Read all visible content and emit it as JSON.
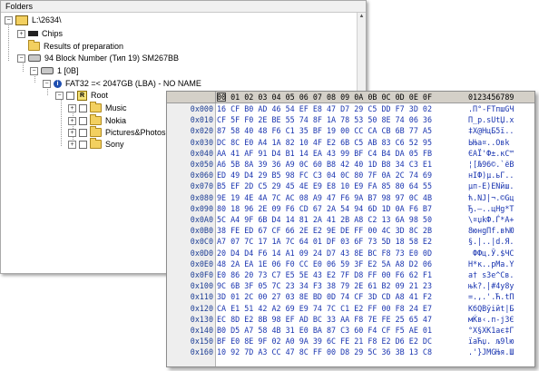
{
  "folders_panel": {
    "title": "Folders",
    "items": [
      {
        "label": "L:\\2634\\",
        "icon": "drive-folder-icon"
      },
      {
        "label": "Chips",
        "icon": "chip-icon"
      },
      {
        "label": "Results of preparation",
        "icon": "folder-icon"
      },
      {
        "label": "94 Block Number (Тип 19) SM267BB",
        "icon": "disk-icon"
      },
      {
        "label": "1 [0B]",
        "icon": "disk-icon"
      },
      {
        "label": "FAT32 =< 2047GB (LBA) - NO NAME",
        "icon": "info-icon"
      },
      {
        "label": "Root",
        "icon": "root-icon"
      },
      {
        "label": "Music",
        "icon": "folder-icon"
      },
      {
        "label": "Nokia",
        "icon": "folder-icon"
      },
      {
        "label": "Pictures&Photos",
        "icon": "folder-icon"
      },
      {
        "label": "Sony",
        "icon": "folder-icon"
      }
    ]
  },
  "hex_view": {
    "columns": "00 01 02 03 04 05 06 07 08 09 0A 0B 0C 0D 0E 0F",
    "ascii_header": "0123456789",
    "rows": [
      {
        "addr": "0x000",
        "hex": "16 CF B0 AD 46 54 EF E8 47 D7 29 C5 DD F7 3D 02",
        "ascii": ".П°-FTпшGЧ"
      },
      {
        "addr": "0x010",
        "hex": "CF 5F F0 2E BE 55 74 8F 1A 78 53 50 8E 74 06 36",
        "ascii": "П_р.sUtЏ.x"
      },
      {
        "addr": "0x020",
        "hex": "87 58 40 48 F6 C1 35 BF 19 00 CC CA CB 6B 77 A5",
        "ascii": "‡X@HцБ5ї.."
      },
      {
        "addr": "0x030",
        "hex": "DC 8C E0 A4 1A 82 10 4F E2 6B C5 AB 83 C6 52 95",
        "ascii": "ЬЊа¤..Oвk"
      },
      {
        "addr": "0x040",
        "hex": "AA 41 AF 91 D4 B1 14 EA 43 99 BF C4 B4 DA 05 FB",
        "ascii": "ЄAЇ'Ф±.кC™"
      },
      {
        "addr": "0x050",
        "hex": "A6 5B 8A 39 36 A9 0C 60 B8 42 40 1D B8 34 C3 E1",
        "ascii": "¦[Љ96©.`ёB"
      },
      {
        "addr": "0x060",
        "hex": "ED 49 D4 29 B5 98 FC C3 04 0C 80 7F 0A 2C 74 69",
        "ascii": "нIФ)µ.ьГ.."
      },
      {
        "addr": "0x070",
        "hex": "B5 EF 2D C5 29 45 4E E9 E8 10 E9 FA 85 80 64 55",
        "ascii": "µп-Е)ENйш."
      },
      {
        "addr": "0x080",
        "hex": "9E 19 4E 4A 7C AC 08 A9 47 F6 9A B7 98 97 0C 4B",
        "ascii": "ћ.NJ|¬.©Gц"
      },
      {
        "addr": "0x090",
        "hex": "80 18 96 2E 09 F6 CD 67 2A 54 94 6D 1D 0A F6 B7",
        "ascii": "Ђ.–..цНg*T"
      },
      {
        "addr": "0x0A0",
        "hex": "5C A4 9F 6B D4 14 81 2A 41 2B A8 C2 13 6A 98 50",
        "ascii": "\\¤џkФ.Ѓ*A+"
      },
      {
        "addr": "0x0B0",
        "hex": "38 FE ED 67 CF 66 2E E2 9E DE FF 00 4C 3D 8C 2B",
        "ascii": "8юнgПf.вћЮ"
      },
      {
        "addr": "0x0C0",
        "hex": "A7 07 7C 17 1A 7C 64 01 DF 03 6F 73 5D 18 58 E2",
        "ascii": "§.|..|d.Я."
      },
      {
        "addr": "0x0D0",
        "hex": "20 D4 D4 F6 14 A1 09 24 D7 43 8E BC F8 73 E0 0D",
        "ascii": " ФФц.Ў.$ЧC"
      },
      {
        "addr": "0x0E0",
        "hex": "48 2A EA 1E 06 F0 CC E0 06 59 3F E2 5A A8 D2 06",
        "ascii": "H*к..рМа.Y"
      },
      {
        "addr": "0x0F0",
        "hex": "E0 86 20 73 C7 E5 5E 43 E2 7F D8 FF 00 F6 62 F1",
        "ascii": "а† sЗе^Cв."
      },
      {
        "addr": "0x100",
        "hex": "9C 6B 3F 05 7C 23 34 F3 38 79 2E 61 B2 09 21 23",
        "ascii": "њk?.|#4у8y"
      },
      {
        "addr": "0x110",
        "hex": "3D 01 2C 00 27 03 8E BD 0D 74 CF 3D CD A8 41 F2",
        "ascii": "=.,.'.Ћ.tП"
      },
      {
        "addr": "0x120",
        "hex": "CA E1 51 42 A2 69 E9 74 7C C1 E2 FF 00 F8 24 E7",
        "ascii": "КбQBўiйt|Б"
      },
      {
        "addr": "0x130",
        "hex": "EC 8D E2 8B 98 EF AD BC 33 AA F8 7E FE 25 65 47",
        "ascii": "мЌв‹.п-ј3Є"
      },
      {
        "addr": "0x140",
        "hex": "B0 D5 A7 58 4B 31 E0 BA 87 C3 60 F4 CF F5 AE 01",
        "ascii": "°Х§XK1ає‡Г"
      },
      {
        "addr": "0x150",
        "hex": "BF E0 8E 9F 02 A0 9A 39 6C FE 21 F8 E2 D6 E2 DC",
        "ascii": "їаЋџ. љ9lю"
      },
      {
        "addr": "0x160",
        "hex": "10 92 7D A3 CC 47 8C FF 00 D8 29 5C 36 3B 13 C8",
        "ascii": ".'}ЈМGЊя.Ш"
      }
    ]
  }
}
